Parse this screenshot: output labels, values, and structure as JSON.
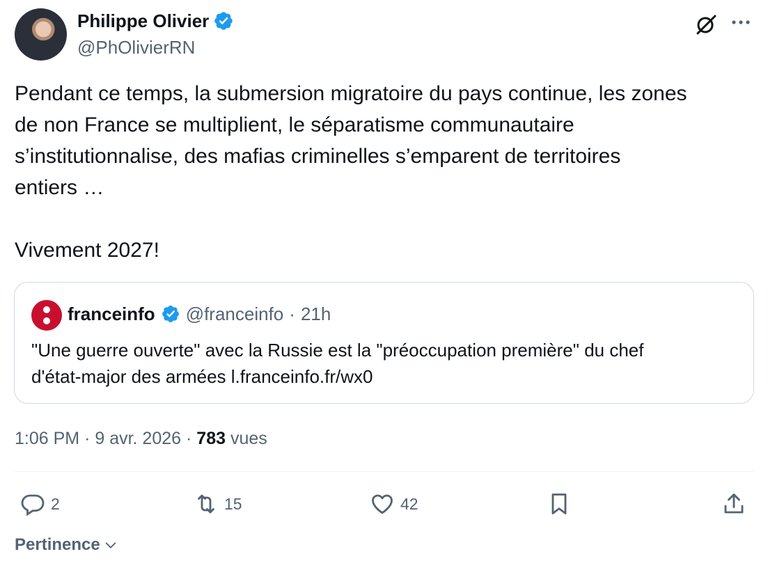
{
  "author": {
    "name": "Philippe Olivier",
    "handle": "@PhOlivierRN",
    "avatar_icon": "profile-photo"
  },
  "tweet": {
    "text": "Pendant ce temps, la submersion migratoire du pays continue, les zones\nde non France se multiplient, le séparatisme communautaire\ns’institutionnalise, des mafias criminelles  s’emparent de territoires\nentiers …\n\nVivement 2027!"
  },
  "quote": {
    "name": "franceinfo",
    "handle": "@franceinfo",
    "separator": "·",
    "time": "21h",
    "text_line1": "\"Une guerre ouverte\" avec la Russie est la \"préoccupation première\" du chef",
    "text_line2": "d'état-major des armées l.franceinfo.fr/wx0"
  },
  "meta": {
    "time": "1:06 PM",
    "separator": "·",
    "date": "9 avr. 2026",
    "views_count": "783",
    "views_label": "vues"
  },
  "actions": {
    "replies": "2",
    "reposts": "15",
    "likes": "42"
  },
  "sort": {
    "label": "Pertinence"
  },
  "colors": {
    "verified": "#1d9bf0",
    "secondary_text": "#536471",
    "border": "#cfd9de",
    "franceinfo_red": "#c8102e"
  },
  "icons": [
    "verified-badge-icon",
    "grok-icon",
    "more-icon",
    "reply-icon",
    "repost-icon",
    "like-icon",
    "bookmark-icon",
    "share-icon",
    "chevron-down-icon"
  ]
}
